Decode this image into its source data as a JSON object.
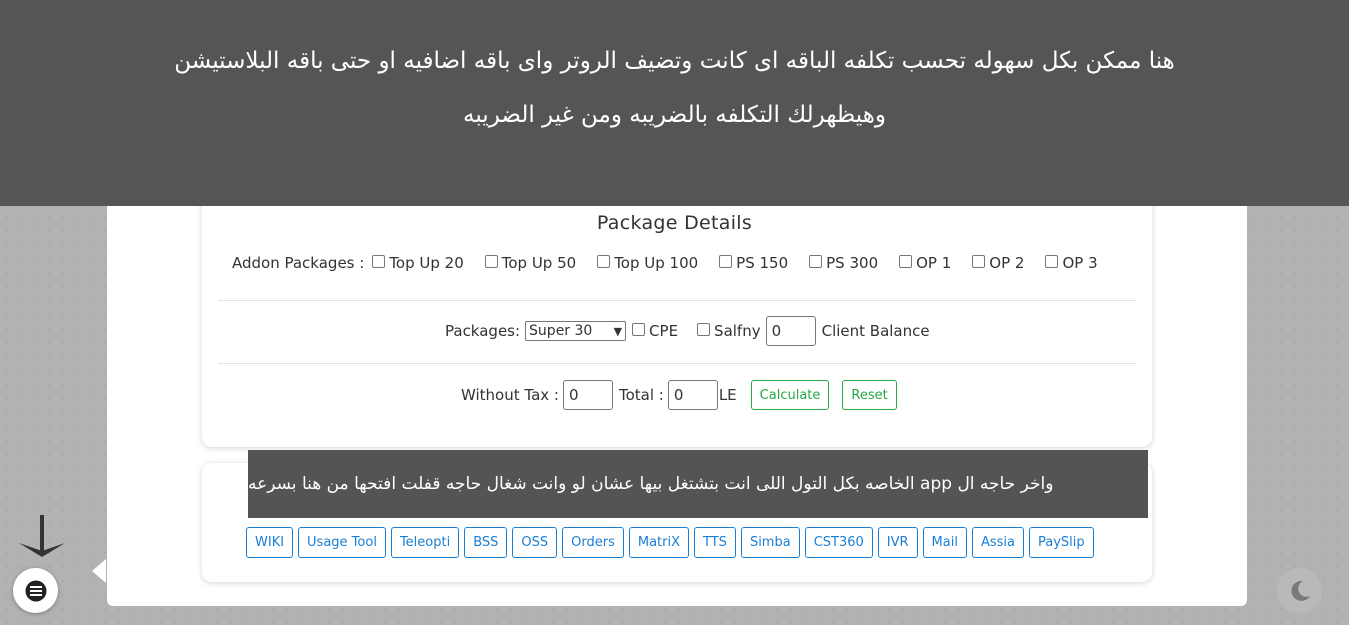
{
  "banner": {
    "line1": "هنا ممكن بكل سهوله تحسب تكلفه الباقه اى كانت وتضيف الروتر واى باقه اضافيه او حتى باقه البلاستيشن",
    "line2": "وهيظهرلك التكلفه بالضريبه ومن غير الضريبه"
  },
  "package": {
    "title": "Package Details",
    "addon_label": "Addon Packages :",
    "addons": [
      "Top Up 20",
      "Top Up 50",
      "Top Up 100",
      "PS 150",
      "PS 300",
      "OP 1",
      "OP 2",
      "OP 3"
    ],
    "packages_label": "Packages:",
    "selected_package": "Super 30",
    "cpe_label": "CPE",
    "salfny_label": "Salfny",
    "client_balance_value": "0",
    "client_balance_label": "Client Balance",
    "without_tax_label": "Without Tax :",
    "without_tax_value": "0",
    "total_label": "Total :",
    "total_value": "0",
    "currency": "LE",
    "calculate_label": "Calculate",
    "reset_label": "Reset"
  },
  "tools": {
    "tooltip": "واخر حاجه ال app الخاصه بكل التول اللى انت بتشتغل بيها عشان لو وانت شغال حاجه قفلت افتحها من هنا بسرعه",
    "buttons": [
      "WIKI",
      "Usage Tool",
      "Teleopti",
      "BSS",
      "OSS",
      "Orders",
      "MatriX",
      "TTS",
      "Simba",
      "CST360",
      "IVR",
      "Mail",
      "Assia",
      "PaySlip"
    ]
  },
  "colors": {
    "banner_bg": "#555555",
    "green_accent": "#28a745",
    "blue_accent": "#1a7fd4"
  },
  "icons": {
    "arrow": "arrow-down-icon",
    "menu": "menu-icon",
    "theme": "moon-icon"
  }
}
